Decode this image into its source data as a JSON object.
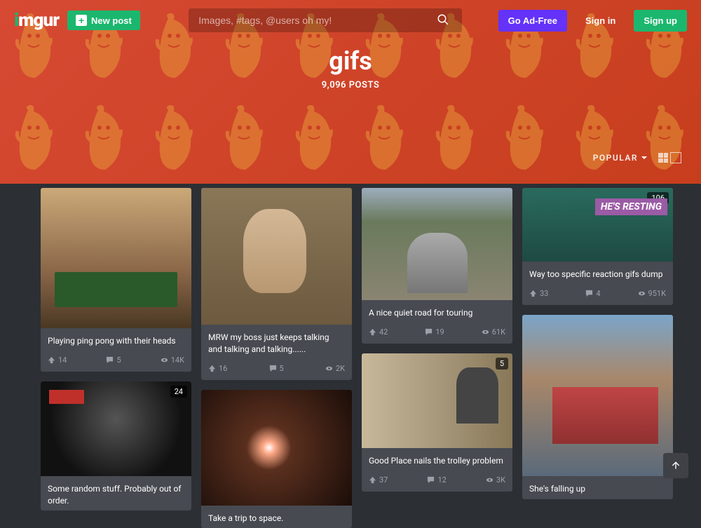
{
  "header": {
    "logo": "imgur",
    "new_post": "New post",
    "search_placeholder": "Images, #tags, @users oh my!",
    "go_adfree": "Go Ad-Free",
    "sign_in": "Sign in",
    "sign_up": "Sign up"
  },
  "tag": {
    "title": "gifs",
    "posts_count": "9,096 POSTS"
  },
  "sort": {
    "label": "POPULAR"
  },
  "cards": {
    "c1": {
      "title": "Playing ping pong with their heads",
      "up": "14",
      "comments": "5",
      "views": "14K"
    },
    "c2": {
      "title": "Some random stuff. Probably out of order.",
      "badge": "24"
    },
    "c3": {
      "title": "MRW my boss just keeps talking and talking and talking......",
      "up": "16",
      "comments": "5",
      "views": "2K"
    },
    "c4": {
      "title": "Take a trip to space."
    },
    "c5": {
      "title": "A nice quiet road for touring",
      "up": "42",
      "comments": "19",
      "views": "61K"
    },
    "c6": {
      "title": "Good Place nails the trolley problem",
      "up": "37",
      "comments": "12",
      "views": "3K",
      "badge": "5"
    },
    "c7": {
      "title": "Way too specific reaction gifs dump",
      "up": "33",
      "comments": "4",
      "views": "951K",
      "badge": "106"
    },
    "c8": {
      "title": "She's falling up"
    }
  }
}
